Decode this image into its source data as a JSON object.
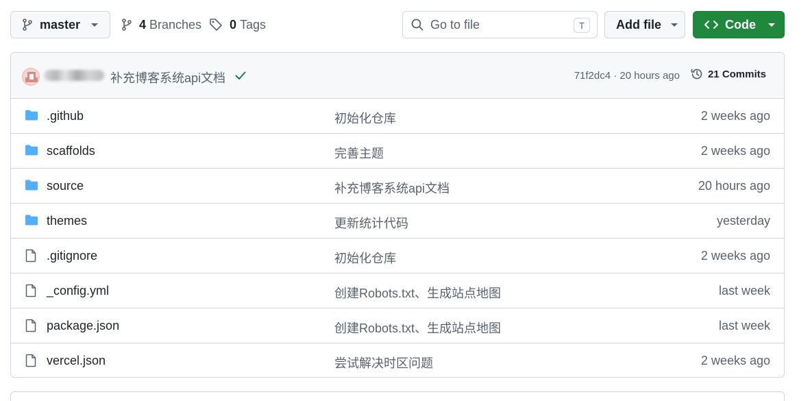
{
  "toolbar": {
    "branch": "master",
    "branches_count": "4",
    "branches_label": "Branches",
    "tags_count": "0",
    "tags_label": "Tags",
    "search_placeholder": "Go to file",
    "search_shortcut": "T",
    "add_file_label": "Add file",
    "code_label": "Code"
  },
  "colors": {
    "primary_button": "#1f883d",
    "folder_icon": "#54aeff",
    "check": "#1a7f37"
  },
  "latest_commit": {
    "message": "补充博客系统api文档",
    "hash": "71f2dc4",
    "time": "20 hours ago",
    "commits_count": "21",
    "commits_label": "Commits",
    "status": "success"
  },
  "files": [
    {
      "type": "folder",
      "name": ".github",
      "message": "初始化仓库",
      "date": "2 weeks ago"
    },
    {
      "type": "folder",
      "name": "scaffolds",
      "message": "完善主题",
      "date": "2 weeks ago"
    },
    {
      "type": "folder",
      "name": "source",
      "message": "补充博客系统api文档",
      "date": "20 hours ago"
    },
    {
      "type": "folder",
      "name": "themes",
      "message": "更新统计代码",
      "date": "yesterday"
    },
    {
      "type": "file",
      "name": ".gitignore",
      "message": "初始化仓库",
      "date": "2 weeks ago"
    },
    {
      "type": "file",
      "name": "_config.yml",
      "message": "创建Robots.txt、生成站点地图",
      "date": "last week"
    },
    {
      "type": "file",
      "name": "package.json",
      "message": "创建Robots.txt、生成站点地图",
      "date": "last week"
    },
    {
      "type": "file",
      "name": "vercel.json",
      "message": "尝试解决时区问题",
      "date": "2 weeks ago"
    }
  ]
}
